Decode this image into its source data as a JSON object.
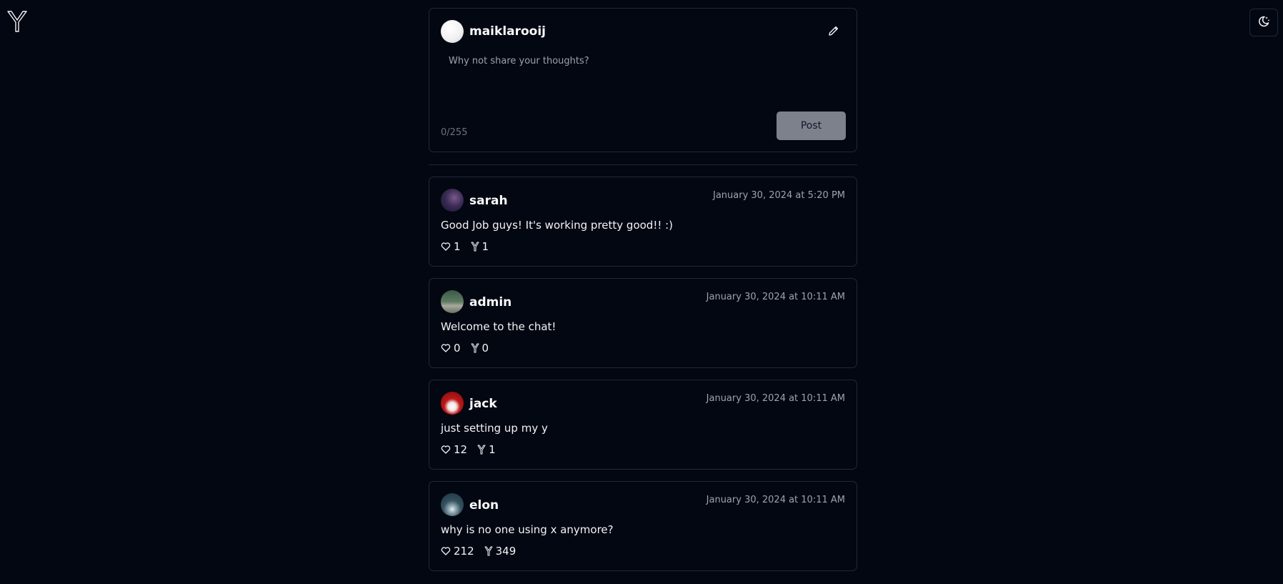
{
  "app": {
    "logo_icon": "y-logo-icon",
    "theme_icon": "moon-stars-icon"
  },
  "composer": {
    "username": "maiklarooij",
    "placeholder": "Why not share your thoughts?",
    "value": "",
    "counter": "0/255",
    "post_label": "Post",
    "edit_icon": "pencil-icon"
  },
  "posts": [
    {
      "username": "sarah",
      "timestamp": "January 30, 2024 at 5:20 PM",
      "content": "Good Job guys! It's working pretty good!! :)",
      "likes": "1",
      "reposts": "1"
    },
    {
      "username": "admin",
      "timestamp": "January 30, 2024 at 10:11 AM",
      "content": "Welcome to the chat!",
      "likes": "0",
      "reposts": "0"
    },
    {
      "username": "jack",
      "timestamp": "January 30, 2024 at 10:11 AM",
      "content": "just setting up my y",
      "likes": "12",
      "reposts": "1"
    },
    {
      "username": "elon",
      "timestamp": "January 30, 2024 at 10:11 AM",
      "content": "why is no one using x anymore?",
      "likes": "212",
      "reposts": "349"
    }
  ]
}
